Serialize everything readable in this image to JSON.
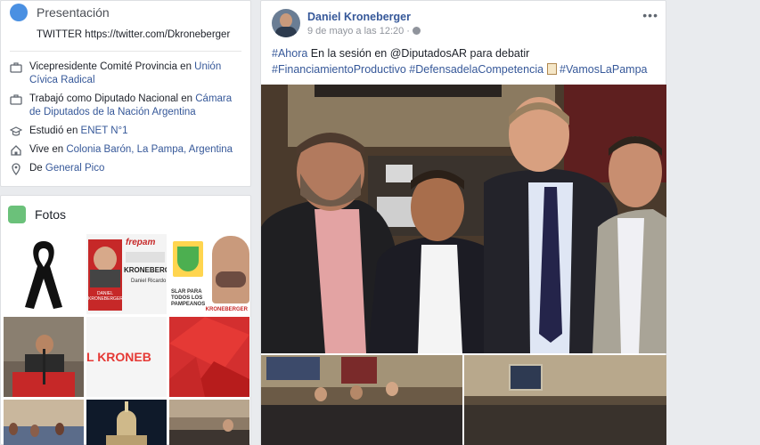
{
  "intro": {
    "title": "Presentación",
    "twitter": "TWITTER https://twitter.com/Dkroneberger",
    "items": [
      {
        "icon": "briefcase-icon",
        "text": "Vicepresidente Comité Provincia en ",
        "link": "Unión Cívica Radical"
      },
      {
        "icon": "briefcase-icon",
        "text": "Trabajó como Diputado Nacional en ",
        "link": "Cámara de Diputados de la Nación Argentina"
      },
      {
        "icon": "graduation-cap-icon",
        "text": "Estudió en ",
        "link": "ENET N°1"
      },
      {
        "icon": "home-icon",
        "text": "Vive en ",
        "link": "Colonia Barón, La Pampa, Argentina"
      },
      {
        "icon": "location-pin-icon",
        "text": "De ",
        "link": "General Pico"
      }
    ]
  },
  "photos": {
    "title": "Fotos",
    "thumb2_texts": [
      "DANIEL KRONEBERGER",
      "frepam",
      "KRONEBERGER",
      "Daniel Ricardo"
    ],
    "thumb3_text": "SLAR PARA TODOS LOS PAMPEANOS",
    "thumb3_caption": "KRONEBERGER",
    "thumb5_text": "L KRONEB"
  },
  "post": {
    "author": "Daniel Kroneberger",
    "time": "9 de mayo a las 12:20 · ",
    "menu": "•••",
    "line1_tag": "#Ahora",
    "line1_text": " En la sesión en @DiputadosAR para debatir",
    "tag2": "#FinanciamientoProductivo",
    "tag3": "#DefensadelaCompetencia",
    "tag4": "#VamosLaPampa"
  },
  "colors": {
    "link": "#365899",
    "bg": "#e9ebee"
  }
}
